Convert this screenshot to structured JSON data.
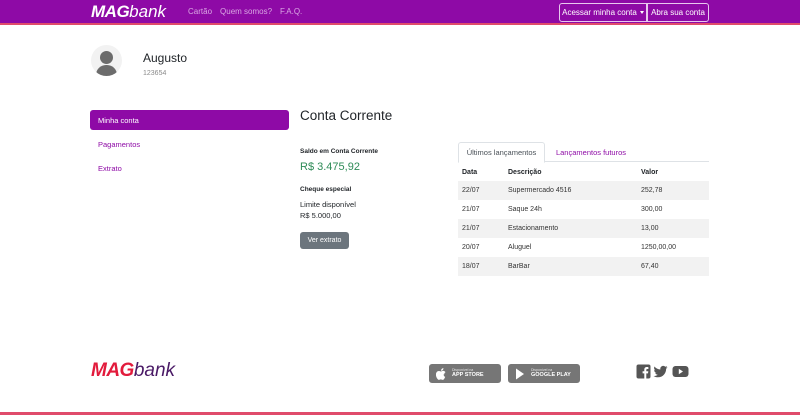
{
  "nav": {
    "logo_mag": "MAG",
    "logo_bank": "bank",
    "links": [
      "Cartão",
      "Quem somos?",
      "F.A.Q."
    ],
    "access_button": "Acessar minha conta",
    "open_account_button": "Abra sua conta"
  },
  "profile": {
    "name": "Augusto",
    "id": "123654"
  },
  "sidebar": {
    "items": [
      {
        "label": "Minha conta",
        "active": true
      },
      {
        "label": "Pagamentos",
        "active": false
      },
      {
        "label": "Extrato",
        "active": false
      }
    ]
  },
  "account": {
    "title": "Conta Corrente",
    "balance_label": "Saldo em Conta Corrente",
    "balance_value": "R$ 3.475,92",
    "cheque_label": "Cheque especial",
    "limit_label": "Limite disponível",
    "limit_value": "R$ 5.000,00",
    "extrato_button": "Ver extrato"
  },
  "tabs": [
    {
      "label": "Últimos lançamentos",
      "active": true
    },
    {
      "label": "Lançamentos futuros",
      "active": false
    }
  ],
  "transactions": {
    "headers": [
      "Data",
      "Descrição",
      "Valor"
    ],
    "rows": [
      [
        "22/07",
        "Supermercado 4516",
        "252,78"
      ],
      [
        "21/07",
        "Saque 24h",
        "300,00"
      ],
      [
        "21/07",
        "Estacionamento",
        "13,00"
      ],
      [
        "20/07",
        "Aluguel",
        "1250,00,00"
      ],
      [
        "18/07",
        "BarBar",
        "67,40"
      ]
    ]
  },
  "footer": {
    "logo_mag": "MAG",
    "logo_bank": "bank",
    "apple_small": "Disponível na",
    "apple_big": "APP STORE",
    "google_small": "Disponível na",
    "google_big": "GOOGLE PLAY",
    "social_icons": [
      "facebook-icon",
      "twitter-icon",
      "youtube-icon"
    ]
  },
  "colors": {
    "brand_purple": "#8e0aa6",
    "brand_red": "#e21b3c",
    "balance_green": "#2e8b57"
  }
}
